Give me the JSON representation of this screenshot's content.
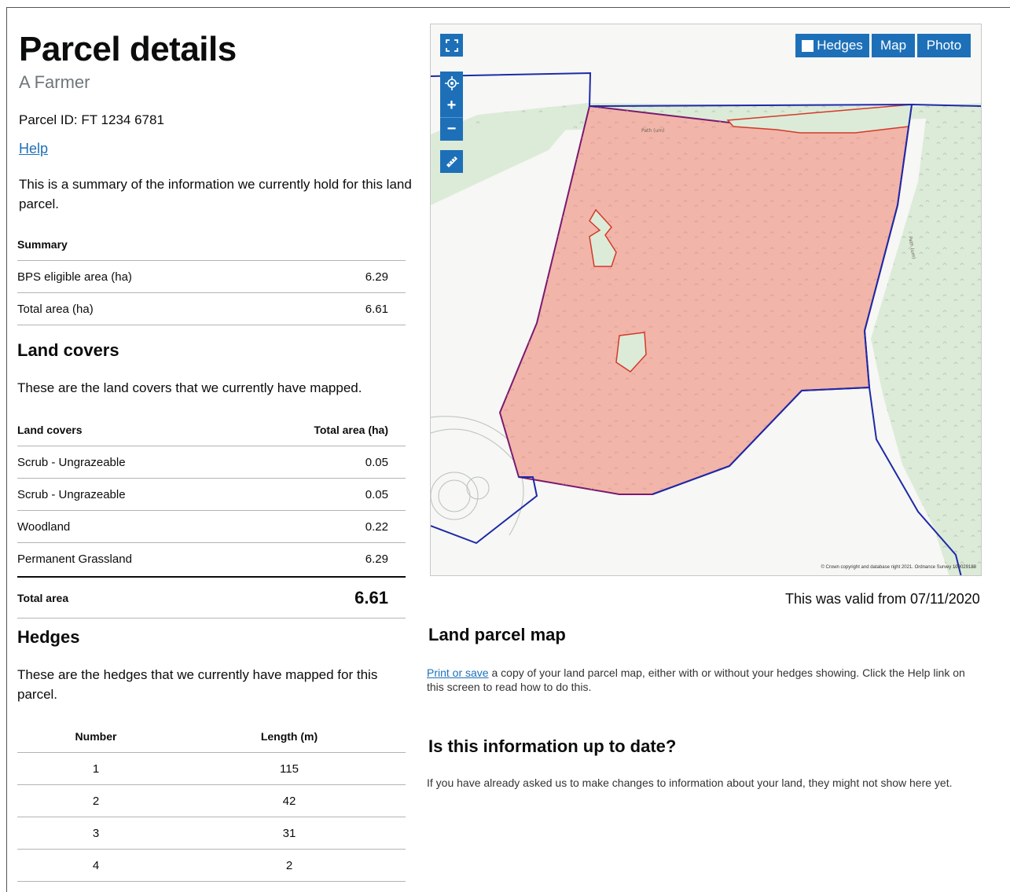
{
  "page": {
    "title": "Parcel details",
    "farmer": "A Farmer",
    "parcel_id": "Parcel ID: FT 1234 6781",
    "help_link": "Help",
    "intro": "This is a summary of the information we currently hold for this land parcel."
  },
  "summary": {
    "heading": "Summary",
    "rows": [
      {
        "label": "BPS eligible area (ha)",
        "value": "6.29"
      },
      {
        "label": "Total area (ha)",
        "value": "6.61"
      }
    ]
  },
  "land_covers": {
    "heading": "Land covers",
    "intro": "These are the land covers that we currently have mapped.",
    "col1": "Land covers",
    "col2": "Total area (ha)",
    "rows": [
      {
        "label": "Scrub - Ungrazeable",
        "value": "0.05"
      },
      {
        "label": "Scrub - Ungrazeable",
        "value": "0.05"
      },
      {
        "label": "Woodland",
        "value": "0.22"
      },
      {
        "label": "Permanent Grassland",
        "value": "6.29"
      }
    ],
    "total_label": "Total area",
    "total_value": "6.61"
  },
  "hedges": {
    "heading": "Hedges",
    "intro": "These are the hedges that we currently have mapped for this parcel.",
    "col1": "Number",
    "col2": "Length (m)",
    "rows": [
      {
        "number": "1",
        "length": "115"
      },
      {
        "number": "2",
        "length": "42"
      },
      {
        "number": "3",
        "length": "31"
      },
      {
        "number": "4",
        "length": "2"
      }
    ]
  },
  "map": {
    "tabs": {
      "hedges": "Hedges",
      "map": "Map",
      "photo": "Photo"
    },
    "zoom_in": "+",
    "zoom_out": "−",
    "copyright": "© Crown copyright and database right 2021. Ordnance Survey 100029188",
    "colors": {
      "parcel_fill": "#f2b5aa",
      "parcel_edge": "#7a1a6e",
      "boundary": "#1d2aa8",
      "woodland": "#dcebd8",
      "controls": "#1d70b8"
    }
  },
  "valid_from": "This was valid from 07/11/2020",
  "land_parcel_map": {
    "heading": "Land parcel map",
    "link": "Print or save",
    "text": " a copy of your land parcel map, either with or without your hedges showing. Click the Help link on this screen to read how to do this."
  },
  "up_to_date": {
    "heading": "Is this information up to date?",
    "text": "If you have already asked us to make changes to information about your land, they might not show here yet."
  }
}
